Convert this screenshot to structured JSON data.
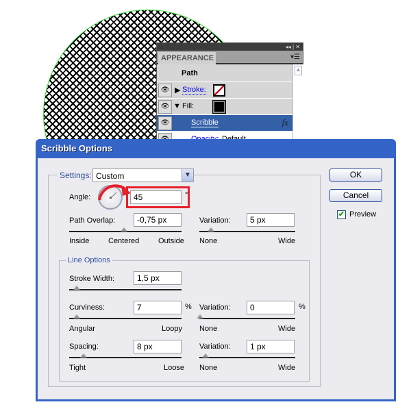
{
  "appearance_panel": {
    "tab": "APPEARANCE",
    "header_controls": "◂◂ | ✕",
    "menu_icon": "panel-menu-icon",
    "target": "Path",
    "rows": [
      {
        "label": "Stroke:"
      },
      {
        "label": "Fill:"
      },
      {
        "label": "Scribble",
        "fx": "fx"
      },
      {
        "label": "Opacity:",
        "value": "Default"
      }
    ]
  },
  "dialog": {
    "title": "Scribble Options",
    "settings_label": "Settings:",
    "settings_value": "Custom",
    "angle_label": "Angle:",
    "angle_value": "45",
    "degree": "°",
    "path_overlap": {
      "label": "Path Overlap:",
      "value": "-0,75 px",
      "min": "Inside",
      "mid": "Centered",
      "max": "Outside",
      "position": 0.49
    },
    "path_overlap_variation": {
      "label": "Variation:",
      "value": "5 px",
      "min": "None",
      "max": "Wide",
      "position": 0.1
    },
    "line_options_label": "Line Options",
    "stroke_width": {
      "label": "Stroke Width:",
      "value": "1,5 px",
      "position": 0.07
    },
    "curviness": {
      "label": "Curviness:",
      "value": "7",
      "unit": "%",
      "min": "Angular",
      "max": "Loopy",
      "position": 0.07
    },
    "curviness_variation": {
      "label": "Variation:",
      "value": "0",
      "unit": "%",
      "min": "None",
      "max": "Wide",
      "position": 0
    },
    "spacing": {
      "label": "Spacing:",
      "value": "8 px",
      "min": "Tight",
      "max": "Loose",
      "position": 0.13
    },
    "spacing_variation": {
      "label": "Variation:",
      "value": "1 px",
      "min": "None",
      "max": "Wide",
      "position": 0.07
    },
    "ok": "OK",
    "cancel": "Cancel",
    "preview": "Preview",
    "preview_checked": true,
    "highlight_color": "#e8202a"
  }
}
